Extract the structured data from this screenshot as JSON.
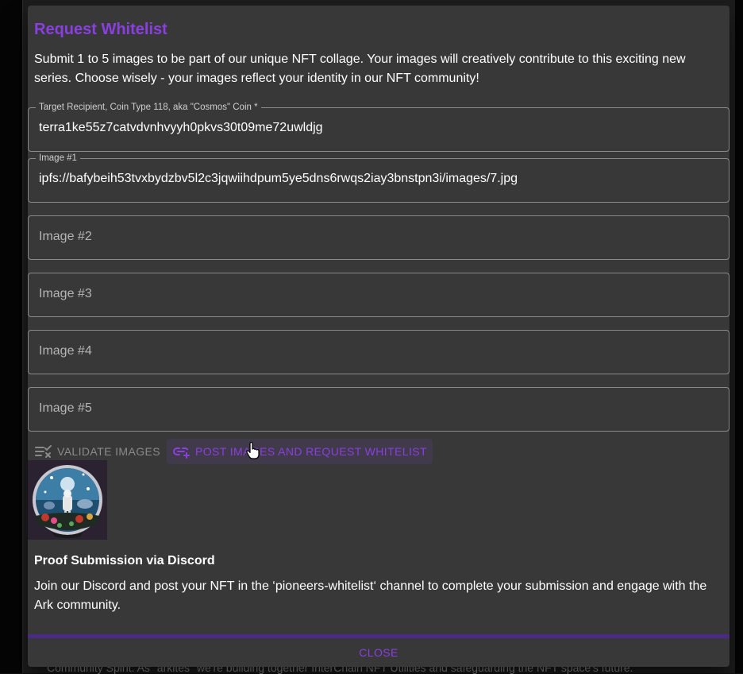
{
  "background": {
    "text": "Community Spirit: As \"arkites\" we're building together InterChain NFT Utilities and safeguarding the NFT space's future."
  },
  "dialog": {
    "title": "Request Whitelist",
    "intro": "Submit 1 to 5 images to be part of our unique NFT collage. Your images will creatively contribute to this exciting new series. Choose wisely - your images reflect your identity in our NFT community!",
    "fields": {
      "recipient": {
        "label": "Target Recipient, Coin Type 118, aka \"Cosmos\" Coin *",
        "value": "terra1ke55z7catvdvnhvyyh0pkvs30t09me72uwldjg"
      },
      "image1": {
        "label": "Image #1",
        "value": "ipfs://bafybeih53tvxbydzbv5l2c3jqwiihdpum5ye5dns6rwqs2iay3bnstpn3i/images/7.jpg"
      },
      "image2": {
        "placeholder": "Image #2"
      },
      "image3": {
        "placeholder": "Image #3"
      },
      "image4": {
        "placeholder": "Image #4"
      },
      "image5": {
        "placeholder": "Image #5"
      }
    },
    "buttons": {
      "validate": "VALIDATE IMAGES",
      "post": "POST IMAGES AND REQUEST WHITELIST",
      "close": "CLOSE"
    },
    "proof": {
      "title": "Proof Submission via Discord",
      "text": "Join our Discord and post your NFT in the ‘pioneers-whitelist‘ channel to complete your submission and engage with the Ark community."
    }
  },
  "colors": {
    "accent": "#8a3fe0",
    "dialog_bg": "#383838",
    "divider": "#4a2a84"
  },
  "icons": {
    "validate": "checklist-x-icon",
    "post": "link-add-icon",
    "cursor": "hand-pointer-icon"
  }
}
